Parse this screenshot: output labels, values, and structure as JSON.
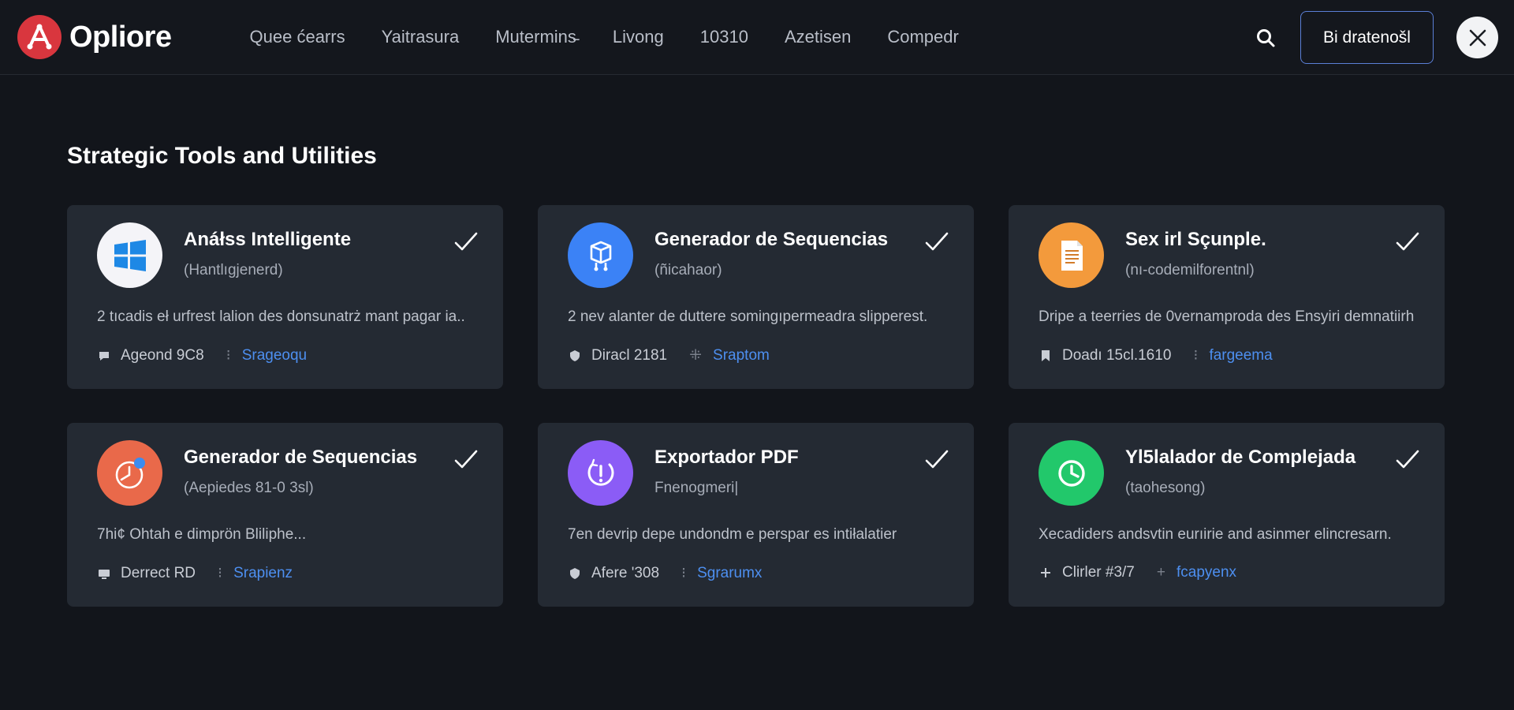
{
  "header": {
    "brand": "Opliore",
    "nav": [
      "Quee ćearrs",
      "Yaitrasura",
      "Mutermins̵",
      "Livong",
      "10310",
      "Azetisen",
      "Compedr"
    ],
    "cta_label": "Bi dratenošl"
  },
  "section": {
    "title": "Strategic Tools and Utilities"
  },
  "cards": [
    {
      "title": "Anáłss Intelligente",
      "subtitle": "(Hantlıgjenerd)",
      "description": "2 tıcadis eł urfrest lalion des donsunatrż mant pagar ia..",
      "meta_text": "Ageond 9C8",
      "meta_link": "Srageoqu",
      "icon": "windows-logo-icon",
      "icon_bg": "#f4f4f8"
    },
    {
      "title": "Generador de Sequencias",
      "subtitle": "(ñicahaor)",
      "description": "2 nev alanter de duttere somingıpermeadra slipperest.",
      "meta_text": "Diracl 2181",
      "meta_link": "Sraptom",
      "icon": "cube-network-icon",
      "icon_bg": "#3b82f6"
    },
    {
      "title": "Sex irl Sçunple.",
      "subtitle": "(nı-codemilforentnl)",
      "description": "Dripe a teerries de 0vernamproda des Ensyiri demnatiirh.",
      "meta_text": "Doadı 15cl.1610",
      "meta_link": "fargeema",
      "icon": "document-icon",
      "icon_bg": "#f39a3c"
    },
    {
      "title": "Generador de Sequencias",
      "subtitle": "(Aepiedes 81-0 3sl)",
      "description": "7hi¢ Ohtah e dimprön Bliliphe...",
      "meta_text": "Derrect RD",
      "meta_link": "Srapienz",
      "icon": "timer-icon",
      "icon_bg": "#e9694a"
    },
    {
      "title": "Exportador PDF",
      "subtitle": "Fnenogmeri|",
      "description": "7en devrip depe undondm e perspar es intiłalatier",
      "meta_text": "Afere '308",
      "meta_link": "Sgrarumx",
      "icon": "alert-cycle-icon",
      "icon_bg": "#8b5cf6"
    },
    {
      "title": "Yl5lalador de Complejada",
      "subtitle": "(taohesong)",
      "description": "Xecadiders andsvtin eurıirie and asinmer elincresarn.",
      "meta_text": "Clirler #3/7",
      "meta_link": "fcapyenx",
      "icon": "clock-check-icon",
      "icon_bg": "#22c86b"
    }
  ]
}
